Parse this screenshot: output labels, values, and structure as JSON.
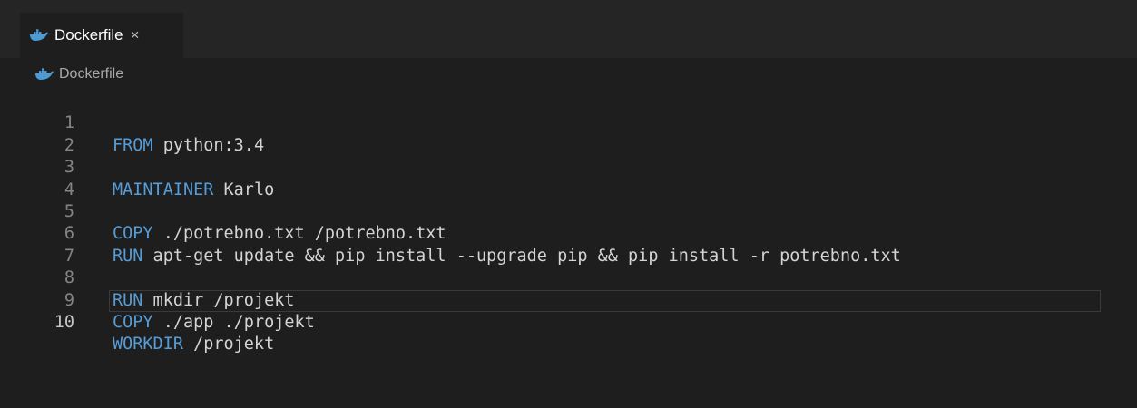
{
  "colors": {
    "background": "#1e1e1e",
    "tab_bar": "#252526",
    "keyword": "#569cd6",
    "text": "#d4d4d4",
    "line_number": "#858585",
    "docker_icon": "#4a9bd6"
  },
  "tab": {
    "label": "Dockerfile",
    "icon": "docker-whale-icon",
    "close_glyph": "×"
  },
  "breadcrumb": {
    "label": "Dockerfile",
    "icon": "docker-whale-icon"
  },
  "code": {
    "lines": [
      {
        "num": "1",
        "kw": "FROM",
        "rest": " python:3.4"
      },
      {
        "num": "2",
        "kw": "",
        "rest": ""
      },
      {
        "num": "3",
        "kw": "MAINTAINER",
        "rest": " Karlo"
      },
      {
        "num": "4",
        "kw": "",
        "rest": ""
      },
      {
        "num": "5",
        "kw": "COPY",
        "rest": " ./potrebno.txt /potrebno.txt"
      },
      {
        "num": "6",
        "kw": "RUN",
        "rest": " apt-get update && pip install --upgrade pip && pip install -r potrebno.txt"
      },
      {
        "num": "7",
        "kw": "",
        "rest": ""
      },
      {
        "num": "8",
        "kw": "RUN",
        "rest": " mkdir /projekt"
      },
      {
        "num": "9",
        "kw": "COPY",
        "rest": " ./app ./projekt"
      },
      {
        "num": "10",
        "kw": "WORKDIR",
        "rest": " /projekt"
      }
    ]
  }
}
